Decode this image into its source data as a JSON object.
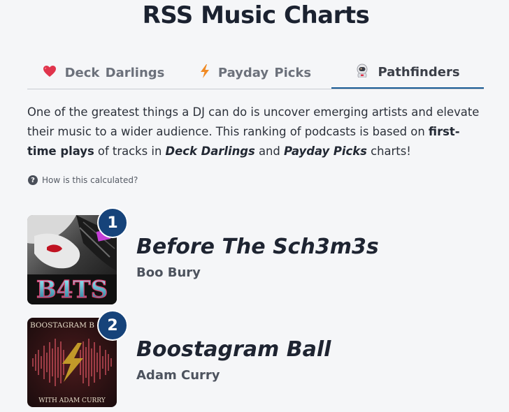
{
  "header": {
    "title": "RSS Music Charts"
  },
  "tabs": [
    {
      "label": "Deck  Darlings",
      "icon": "heart-icon",
      "active": false
    },
    {
      "label": "Payday  Picks",
      "icon": "lightning-bolt-icon",
      "active": false
    },
    {
      "label": "Pathfinders",
      "icon": "astronaut-icon",
      "active": true
    }
  ],
  "description": {
    "part1": "One of the greatest things a DJ can do is uncover emerging artists and elevate their music to a wider audience. This ranking of podcasts is based on ",
    "bold1": "first-time plays",
    "part2": " of tracks in ",
    "chart1": "Deck Darlings",
    "part3": " and ",
    "chart2": "Payday Picks",
    "part4": " charts!"
  },
  "help": {
    "icon": "question-circle-icon",
    "label": "How is this calculated?"
  },
  "entries": [
    {
      "rank": "1",
      "title": "Before The Sch3m3s",
      "artist": "Boo Bury",
      "cover_text": "B4TS"
    },
    {
      "rank": "2",
      "title": "Boostagram Ball",
      "artist": "Adam Curry",
      "cover_text_top": "BOOSTAGRAM B",
      "cover_text_bottom": "WITH ADAM CURRY"
    }
  ],
  "colors": {
    "background": "#f5f6f8",
    "accent": "#1a5c96",
    "badge": "#16437a",
    "heart": "#e0344c",
    "bolt": "#f08a24"
  }
}
